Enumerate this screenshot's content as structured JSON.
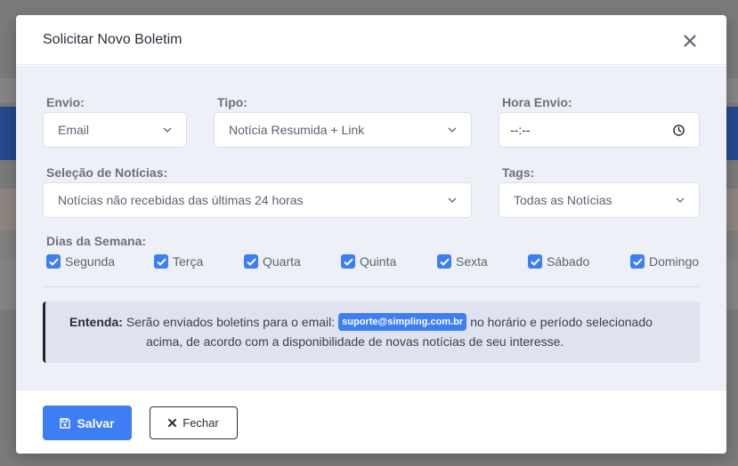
{
  "modal": {
    "title": "Solicitar Novo Boletim"
  },
  "form": {
    "envio": {
      "label": "Envio:",
      "value": "Email"
    },
    "tipo": {
      "label": "Tipo:",
      "value": "Notícia Resumida + Link"
    },
    "hora_envio": {
      "label": "Hora Envio:",
      "value": "--:--"
    },
    "selecao": {
      "label": "Seleção de Notícias:",
      "value": "Notícias não recebidas das últimas 24 horas"
    },
    "tags": {
      "label": "Tags:",
      "value": "Todas as Notícias"
    },
    "dias": {
      "label": "Dias da Semana:",
      "items": [
        {
          "label": "Segunda",
          "checked": true
        },
        {
          "label": "Terça",
          "checked": true
        },
        {
          "label": "Quarta",
          "checked": true
        },
        {
          "label": "Quinta",
          "checked": true
        },
        {
          "label": "Sexta",
          "checked": true
        },
        {
          "label": "Sábado",
          "checked": true
        },
        {
          "label": "Domingo",
          "checked": true
        }
      ]
    }
  },
  "info": {
    "strong": "Entenda:",
    "text_before": "Serão enviados boletins para o email:",
    "email": "suporte@simpling.com.br",
    "text_after": "no horário e período selecionado",
    "text_line2": "acima, de acordo com a disponibilidade de novas notícias de seu interesse."
  },
  "footer": {
    "save_label": "Salvar",
    "close_label": "Fechar"
  },
  "colors": {
    "accent": "#3d7ef5",
    "body_bg": "#eef0f8",
    "info_bg": "#dfe2ef"
  },
  "icons": {
    "close": "close-icon",
    "chevron": "chevron-down-icon",
    "clock": "clock-icon",
    "check": "check-icon",
    "save": "save-icon",
    "x": "x-icon"
  }
}
